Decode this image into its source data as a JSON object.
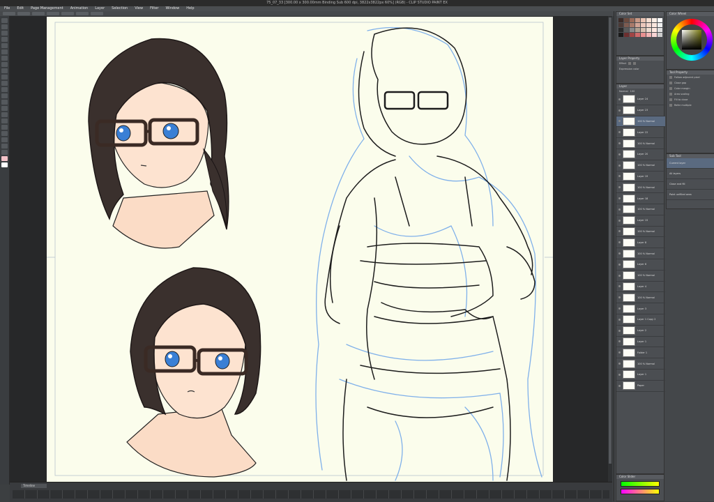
{
  "window": {
    "title": "75_07_33 [300.00 x 300.00mm Binding Sub 600 dpi, 3822x3822px 60%] (RGB) - CLIP STUDIO PAINT EX"
  },
  "menu": {
    "items": [
      "File",
      "Edit",
      "Page Management",
      "Animation",
      "Layer",
      "Selection",
      "View",
      "Filter",
      "Window",
      "Help"
    ]
  },
  "panels": {
    "color_set": {
      "title": "Color Set",
      "swatches": [
        "#3b2a26",
        "#6b4a3e",
        "#9b6b5a",
        "#c99a87",
        "#e9c3b3",
        "#f6dfd2",
        "#fbeee6",
        "#ffffff",
        "#4a3a36",
        "#7d5b50",
        "#a87a6a",
        "#d2a596",
        "#ecc8bc",
        "#f3d7cd",
        "#fae7df",
        "#f0f0f0",
        "#2a2a2a",
        "#5a5a5a",
        "#8a8a8a",
        "#b0a090",
        "#d8c0b0",
        "#eddcd0",
        "#ffe8e0",
        "#e0e0e0",
        "#1a1a1a",
        "#6d2f2f",
        "#a04545",
        "#d06a6a",
        "#e89090",
        "#f2b4b4",
        "#f8d4d4",
        "#cccccc"
      ]
    },
    "color_wheel": {
      "title": "Color Wheel"
    },
    "layer_property": {
      "title": "Layer Property",
      "effect_label": "Effect",
      "expression_color_label": "Expression color"
    },
    "tool_property": {
      "title": "Tool Property",
      "rows": [
        "Follow adjacent pixel",
        "Close gap",
        "Color margin",
        "Area scaling",
        "Fill to close",
        "Refer multiple"
      ]
    },
    "layers": {
      "title": "Layer",
      "blend_mode": "Normal",
      "opacity": "100",
      "items": [
        {
          "name": "Layer 24",
          "selected": false
        },
        {
          "name": "Layer 23",
          "selected": false
        },
        {
          "name": "100 % Normal",
          "selected": true
        },
        {
          "name": "Layer 22",
          "selected": false
        },
        {
          "name": "100 % Normal",
          "selected": false
        },
        {
          "name": "Layer 20",
          "selected": false
        },
        {
          "name": "100 % Normal",
          "selected": false
        },
        {
          "name": "Layer 19",
          "selected": false
        },
        {
          "name": "100 % Normal",
          "selected": false
        },
        {
          "name": "Layer 18",
          "selected": false
        },
        {
          "name": "100 % Normal",
          "selected": false
        },
        {
          "name": "Layer 15",
          "selected": false
        },
        {
          "name": "100 % Normal",
          "selected": false
        },
        {
          "name": "Layer 8",
          "selected": false
        },
        {
          "name": "100 % Normal",
          "selected": false
        },
        {
          "name": "Layer 6",
          "selected": false
        },
        {
          "name": "100 % Normal",
          "selected": false
        },
        {
          "name": "Layer 4",
          "selected": false
        },
        {
          "name": "100 % Normal",
          "selected": false
        },
        {
          "name": "Layer 3",
          "selected": false
        },
        {
          "name": "Layer 1 Copy 2",
          "selected": false
        },
        {
          "name": "Layer 2",
          "selected": false
        },
        {
          "name": "Layer 1",
          "selected": false
        },
        {
          "name": "Folder 1",
          "selected": false
        },
        {
          "name": "100 % Normal",
          "selected": false
        },
        {
          "name": "Layer 1",
          "selected": false
        },
        {
          "name": "Paper",
          "selected": false
        }
      ]
    },
    "sub_tool": {
      "title": "Sub Tool",
      "items": [
        {
          "name": "Current layer",
          "selected": true
        },
        {
          "name": "All layers",
          "selected": false
        },
        {
          "name": "Close and fill",
          "selected": false
        },
        {
          "name": "Paint unfilled area",
          "selected": false
        }
      ]
    },
    "color_slider": {
      "title": "Color Slider"
    }
  },
  "timeline": {
    "title": "Timeline"
  }
}
